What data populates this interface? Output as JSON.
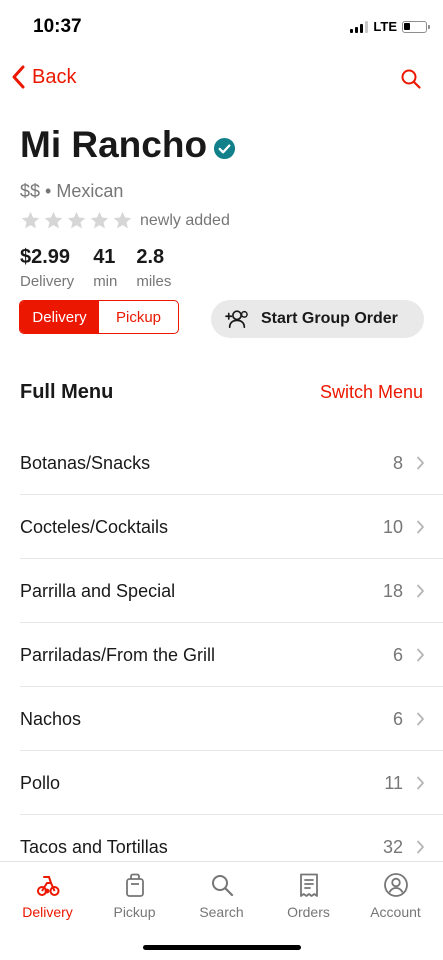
{
  "status_bar": {
    "time": "10:37",
    "network": "LTE"
  },
  "nav": {
    "back_label": "Back"
  },
  "store": {
    "name": "Mi Rancho",
    "meta": "$$ • Mexican",
    "rating_text": "newly added",
    "rating_stars_filled": 0,
    "stats": [
      {
        "value": "$2.99",
        "label": "Delivery"
      },
      {
        "value": "41",
        "label": "min"
      },
      {
        "value": "2.8",
        "label": "miles"
      }
    ]
  },
  "fulfillment_toggle": {
    "delivery": "Delivery",
    "pickup": "Pickup",
    "selected": "Delivery"
  },
  "group_order": {
    "label": "Start Group Order"
  },
  "menu": {
    "title": "Full Menu",
    "switch_label": "Switch Menu",
    "categories": [
      {
        "name": "Botanas/Snacks",
        "count": "8"
      },
      {
        "name": "Cocteles/Cocktails",
        "count": "10"
      },
      {
        "name": "Parrilla and Special",
        "count": "18"
      },
      {
        "name": "Parriladas/From the Grill",
        "count": "6"
      },
      {
        "name": "Nachos",
        "count": "6"
      },
      {
        "name": "Pollo",
        "count": "11"
      },
      {
        "name": "Tacos and Tortillas",
        "count": "32"
      }
    ]
  },
  "tab_bar": {
    "tabs": [
      {
        "label": "Delivery",
        "icon": "scooter-icon",
        "active": true
      },
      {
        "label": "Pickup",
        "icon": "bag-icon",
        "active": false
      },
      {
        "label": "Search",
        "icon": "search-icon",
        "active": false
      },
      {
        "label": "Orders",
        "icon": "receipt-icon",
        "active": false
      },
      {
        "label": "Account",
        "icon": "account-icon",
        "active": false
      }
    ]
  },
  "colors": {
    "accent": "#eb1700",
    "verified": "#11808a",
    "star_empty": "#d6d6d6",
    "text_secondary": "#767676"
  }
}
